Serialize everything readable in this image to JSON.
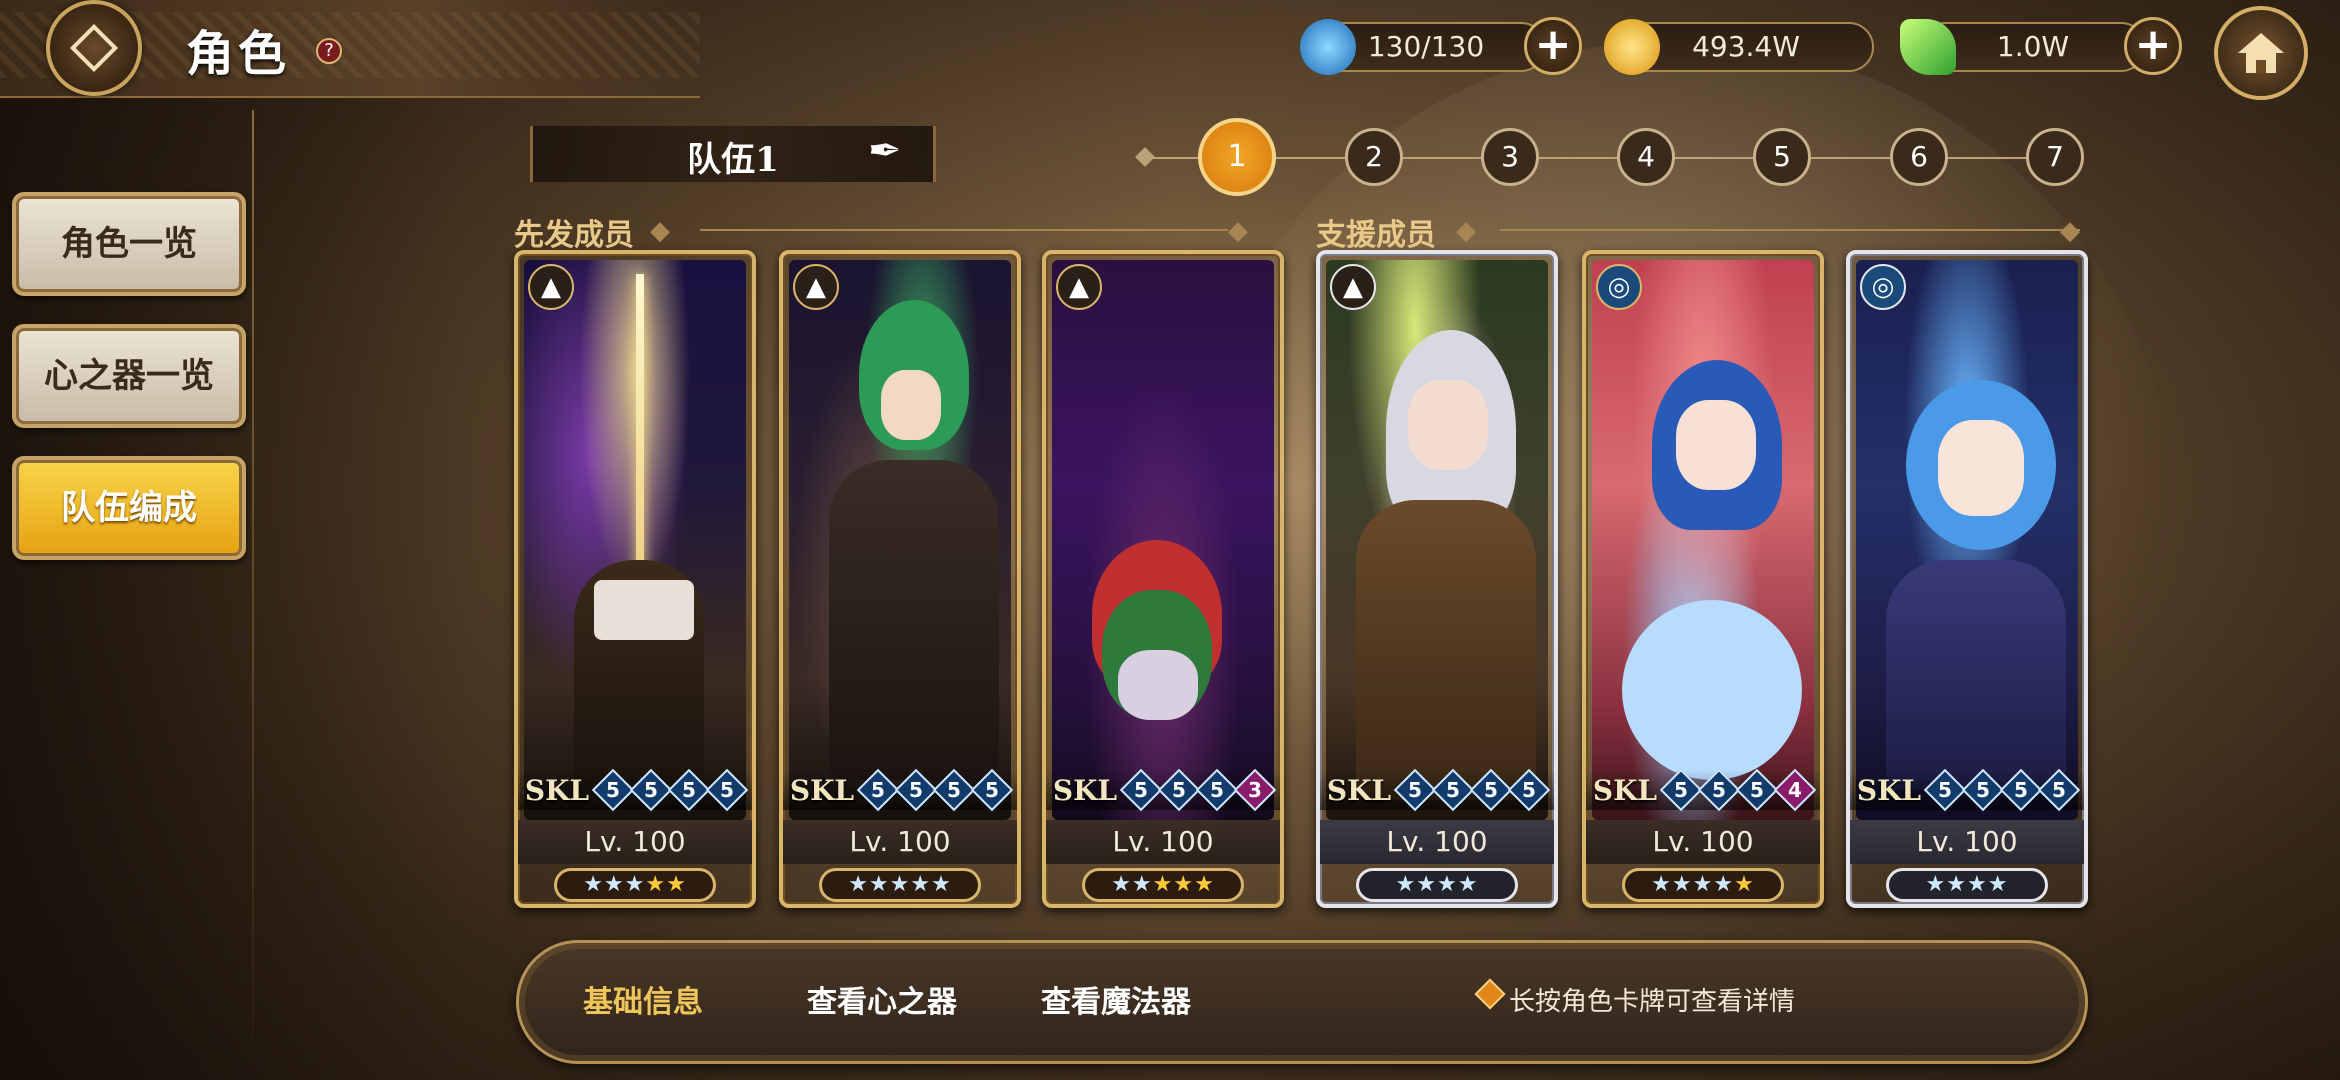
{
  "header": {
    "title": "角色",
    "help": "?"
  },
  "resources": {
    "stamina": "130/130",
    "gold": "493.4W",
    "gems": "1.0W",
    "plus": "+"
  },
  "sidebar": {
    "items": [
      {
        "label": "角色一览"
      },
      {
        "label": "心之器一览"
      },
      {
        "label": "队伍编成"
      }
    ],
    "active_index": 2
  },
  "team": {
    "name": "队伍1",
    "steps": [
      "1",
      "2",
      "3",
      "4",
      "5",
      "6",
      "7"
    ],
    "active_step": "1"
  },
  "sections": {
    "starters": "先发成员",
    "support": "支援成员"
  },
  "cards": [
    {
      "skl_label": "SKL",
      "skills": [
        "5",
        "5",
        "5",
        "5"
      ],
      "level": "Lv. 100",
      "element": "earth-icon",
      "frame": "gold",
      "rarity_stars": 5
    },
    {
      "skl_label": "SKL",
      "skills": [
        "5",
        "5",
        "5",
        "5"
      ],
      "level": "Lv. 100",
      "element": "earth-icon",
      "frame": "gold",
      "rarity_stars": 5
    },
    {
      "skl_label": "SKL",
      "skills": [
        "5",
        "5",
        "5",
        "3"
      ],
      "level": "Lv. 100",
      "element": "earth-icon",
      "frame": "gold",
      "rarity_stars": 5
    },
    {
      "skl_label": "SKL",
      "skills": [
        "5",
        "5",
        "5",
        "5"
      ],
      "level": "Lv. 100",
      "element": "earth-icon",
      "frame": "silver",
      "rarity_stars": 4
    },
    {
      "skl_label": "SKL",
      "skills": [
        "5",
        "5",
        "5",
        "4"
      ],
      "level": "Lv. 100",
      "element": "water-icon",
      "frame": "gold",
      "rarity_stars": 5
    },
    {
      "skl_label": "SKL",
      "skills": [
        "5",
        "5",
        "5",
        "5"
      ],
      "level": "Lv. 100",
      "element": "water-icon",
      "frame": "silver",
      "rarity_stars": 4
    }
  ],
  "bottom": {
    "tabs": [
      "基础信息",
      "查看心之器",
      "查看魔法器"
    ],
    "hint": "长按角色卡牌可查看详情"
  },
  "colors": {
    "accent": "#e5a110",
    "gold_frame": "#d9b56a",
    "silver_frame": "#e4e4ea"
  }
}
